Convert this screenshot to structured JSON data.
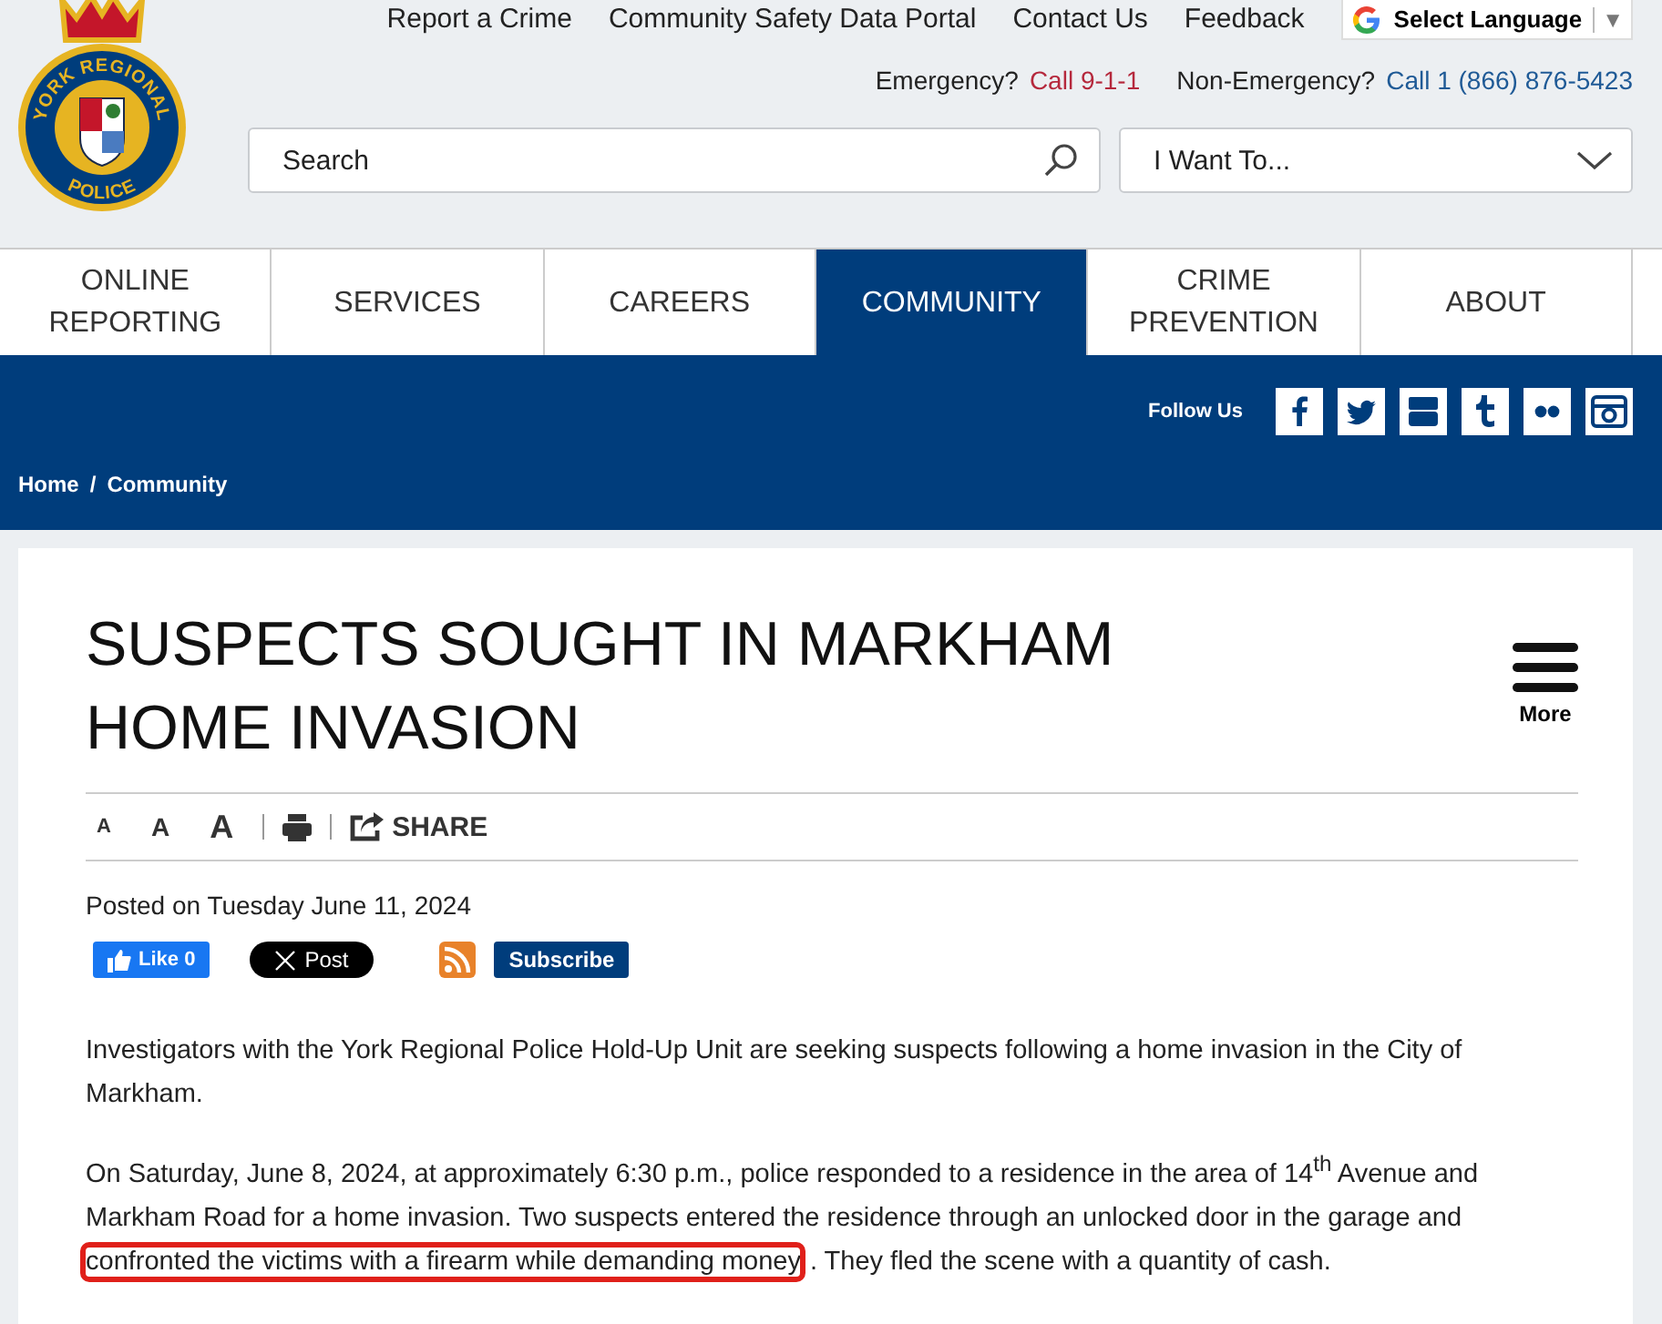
{
  "header": {
    "logo_top": "YORK REGIONAL",
    "logo_bottom": "POLICE",
    "top_links": [
      "Report a Crime",
      "Community Safety Data Portal",
      "Contact Us",
      "Feedback"
    ],
    "language": {
      "label": "Select Language",
      "arrow": "▼"
    },
    "emergency": {
      "label": "Emergency?",
      "phone": "Call 9-1-1"
    },
    "non_emergency": {
      "label": "Non-Emergency?",
      "phone": "Call 1 (866) 876-5423"
    },
    "search": {
      "placeholder": "Search"
    },
    "dropdown": {
      "value": "I Want To..."
    }
  },
  "nav": [
    {
      "label": "ONLINE REPORTING",
      "selected": false
    },
    {
      "label": "SERVICES",
      "selected": false
    },
    {
      "label": "CAREERS",
      "selected": false
    },
    {
      "label": "COMMUNITY",
      "selected": true
    },
    {
      "label": "CRIME PREVENTION",
      "selected": false
    },
    {
      "label": "ABOUT",
      "selected": false
    }
  ],
  "band": {
    "breadcrumb": [
      "Home",
      "Community"
    ],
    "separator": "/",
    "follow_label": "Follow Us"
  },
  "article": {
    "title": "SUSPECTS SOUGHT IN MARKHAM HOME INVASION",
    "more": "More",
    "font_sizes": [
      "A",
      "A",
      "A"
    ],
    "share": "SHARE",
    "posted_label": "Posted on",
    "date": "Tuesday June 11, 2024",
    "like": "Like 0",
    "post": "Post",
    "subscribe": "Subscribe",
    "paragraphs": [
      {
        "before": "Investigators with the York Regional Police Hold-Up Unit are seeking suspects following a home invasion in the City of Markham."
      },
      {
        "before": "On Saturday, June 8, 2024, at approximately 6:30 p.m., police responded to a residence in the area of 14$^{th}$ Avenue and Markham Road for a home invasion. Two suspects entered the residence through an unlocked door in the garage and ",
        "highlight": "confronted the victims with a firearm while demanding money",
        "after": ". They fled the scene with a quantity of cash."
      }
    ]
  }
}
